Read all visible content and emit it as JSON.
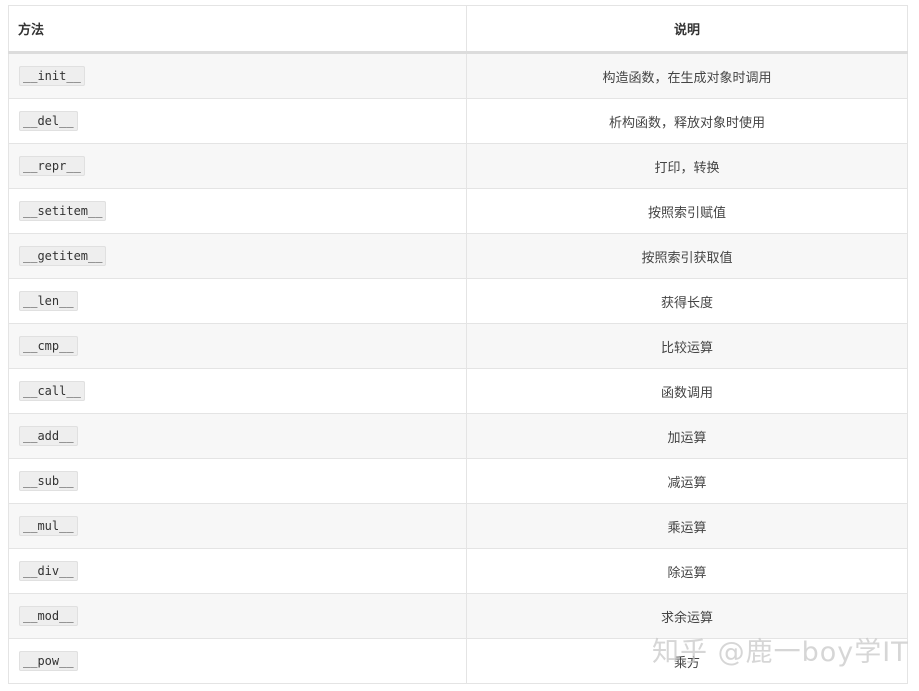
{
  "table": {
    "headers": [
      "方法",
      "说明"
    ],
    "rows": [
      {
        "method": "__init__",
        "desc": "构造函数，在生成对象时调用"
      },
      {
        "method": "__del__",
        "desc": "析构函数，释放对象时使用"
      },
      {
        "method": "__repr__",
        "desc": "打印，转换"
      },
      {
        "method": "__setitem__",
        "desc": "按照索引赋值"
      },
      {
        "method": "__getitem__",
        "desc": "按照索引获取值"
      },
      {
        "method": "__len__",
        "desc": "获得长度"
      },
      {
        "method": "__cmp__",
        "desc": "比较运算"
      },
      {
        "method": "__call__",
        "desc": "函数调用"
      },
      {
        "method": "__add__",
        "desc": "加运算"
      },
      {
        "method": "__sub__",
        "desc": "减运算"
      },
      {
        "method": "__mul__",
        "desc": "乘运算"
      },
      {
        "method": "__div__",
        "desc": "除运算"
      },
      {
        "method": "__mod__",
        "desc": "求余运算"
      },
      {
        "method": "__pow__",
        "desc": "乘方"
      }
    ]
  },
  "watermark": "知乎 @鹿一boy学IT"
}
